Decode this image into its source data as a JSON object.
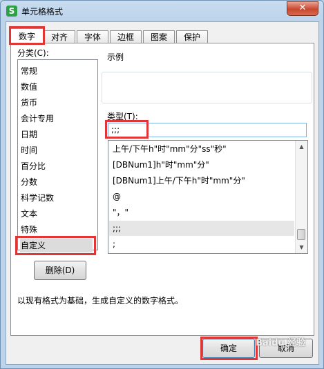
{
  "window": {
    "title": "单元格格式",
    "app_icon_letter": "S",
    "close_glyph": "✕"
  },
  "tabs": [
    {
      "label": "数字",
      "active": true
    },
    {
      "label": "对齐"
    },
    {
      "label": "字体"
    },
    {
      "label": "边框"
    },
    {
      "label": "图案"
    },
    {
      "label": "保护"
    }
  ],
  "category": {
    "label": "分类(C):",
    "items": [
      "常规",
      "数值",
      "货币",
      "会计专用",
      "日期",
      "时间",
      "百分比",
      "分数",
      "科学记数",
      "文本",
      "特殊",
      "自定义"
    ],
    "selected": "自定义"
  },
  "sample": {
    "label": "示例"
  },
  "type": {
    "label": "类型(T):",
    "value": ";;;",
    "formats": [
      "上午/下午h\"时\"mm\"分\"ss\"秒\"",
      "[DBNum1]h\"时\"mm\"分\"",
      "[DBNum1]上午/下午h\"时\"mm\"分\"",
      "@",
      "\"，\"",
      ";;;",
      ";"
    ],
    "selected": ";;;"
  },
  "buttons": {
    "delete": "删除(D)",
    "ok": "确定",
    "cancel": "取消"
  },
  "description": "以现有格式为基础，生成自定义的数字格式。",
  "watermark": "Baidu 经验",
  "colors": {
    "highlight": "#e23636",
    "selection": "#dcdcdc",
    "app_icon": "#2e9f46"
  }
}
